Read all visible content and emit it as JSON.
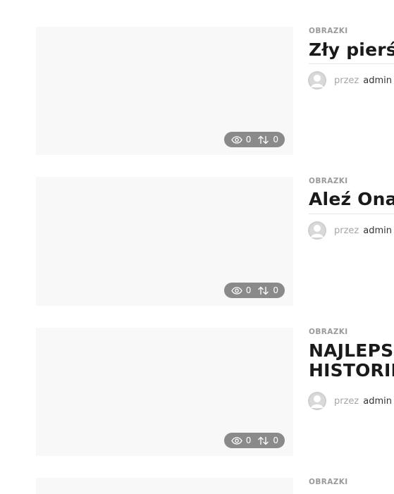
{
  "posts": [
    {
      "category": "OBRAZKI",
      "title_lines": [
        "Zły pierśc"
      ],
      "by_label": "przez",
      "author": "admin",
      "views": "0",
      "shares": "0"
    },
    {
      "category": "OBRAZKI",
      "title_lines": [
        "Aleź Ona"
      ],
      "by_label": "przez",
      "author": "admin",
      "views": "0",
      "shares": "0"
    },
    {
      "category": "OBRAZKI",
      "title_lines": [
        "NAJLEPS",
        "HISTORII"
      ],
      "by_label": "przez",
      "author": "admin",
      "views": "0",
      "shares": "0"
    },
    {
      "category": "OBRAZKI"
    }
  ],
  "icons": {
    "views": "eye-icon",
    "shares": "swap-arrows-icon",
    "avatar": "user-avatar-icon"
  },
  "colors": {
    "stats_pill": "#8a8a8a",
    "thumbnail": "#f8f8f8",
    "category": "#9a9a9a",
    "title": "#1a1a1a"
  }
}
